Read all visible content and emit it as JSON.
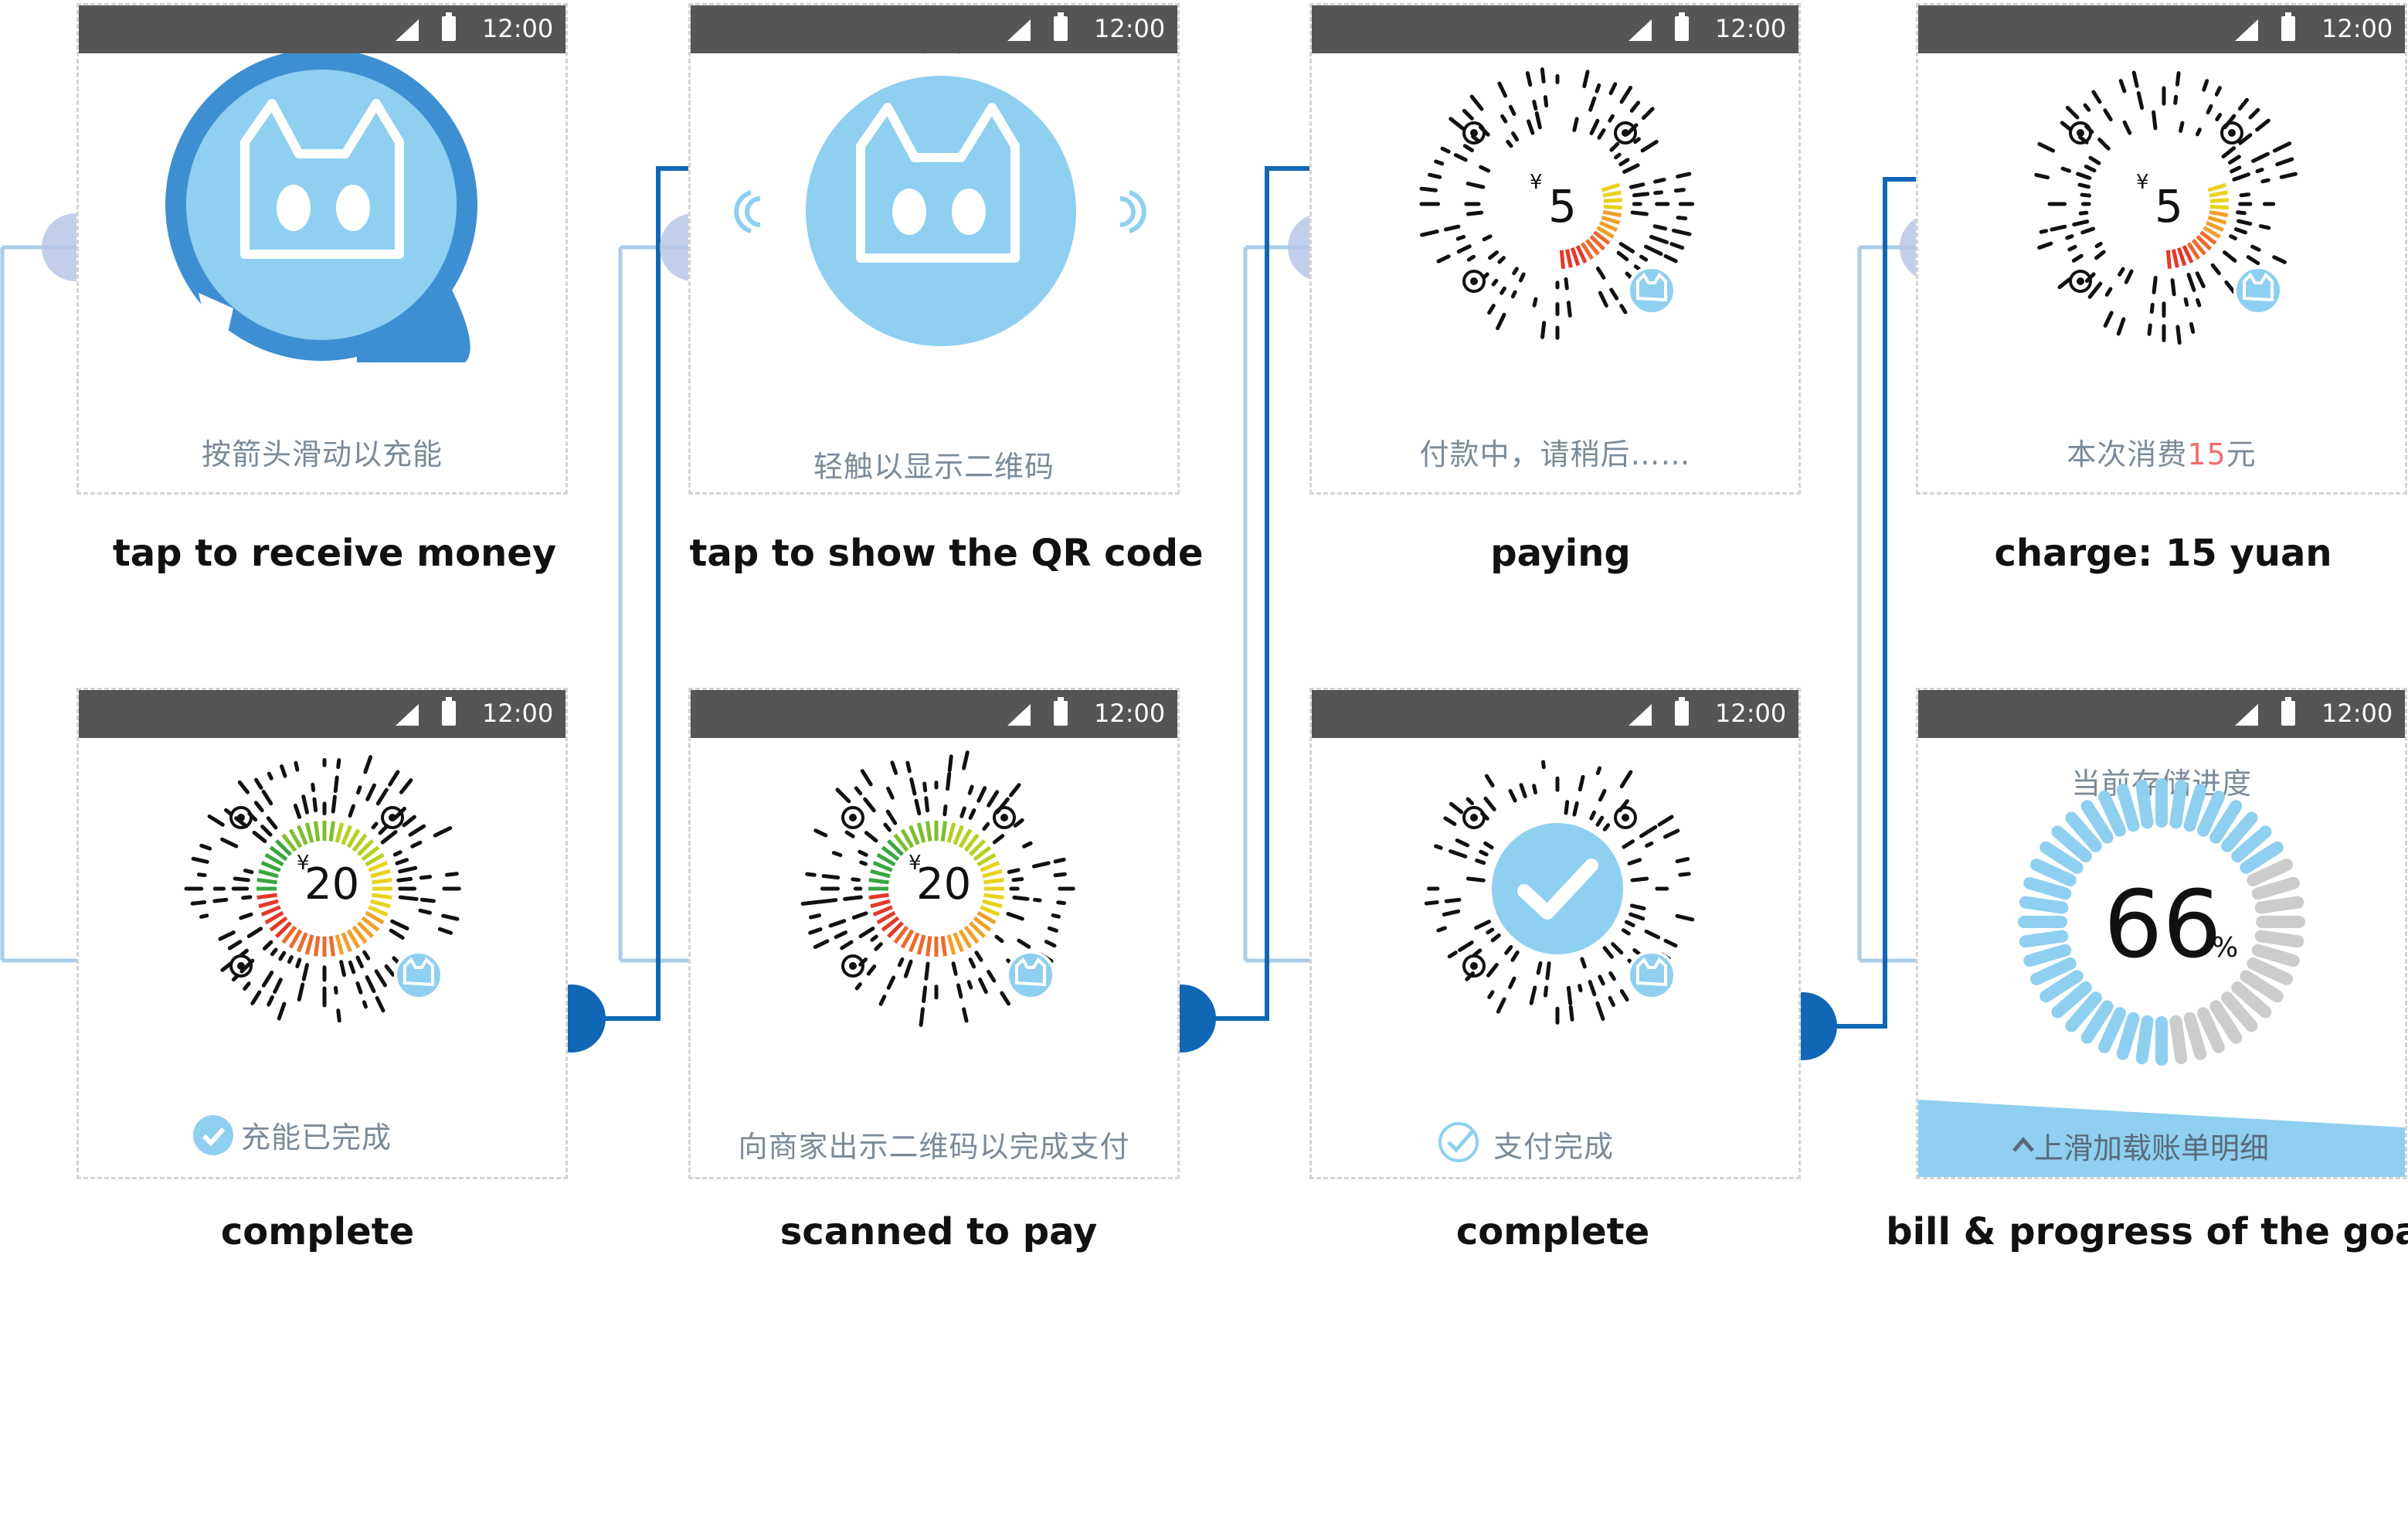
{
  "status": {
    "time": "12:00"
  },
  "screens": [
    {
      "caption": "按箭头滑动以充能",
      "label": "tap to receive money"
    },
    {
      "caption": "轻触以显示二维码",
      "label": "tap to show the QR code"
    },
    {
      "caption": "付款中，请稍后……",
      "label": "paying",
      "amount": "5",
      "currency": "¥"
    },
    {
      "caption_before": "本次消费",
      "caption_highlight": "15",
      "caption_after": "元",
      "label": "charge: 15 yuan",
      "amount": "5",
      "currency": "¥"
    },
    {
      "caption": "充能已完成",
      "label": "complete",
      "amount": "20",
      "currency": "¥"
    },
    {
      "caption": "向商家出示二维码以完成支付",
      "label": "scanned to pay",
      "amount": "20",
      "currency": "¥"
    },
    {
      "caption": "支付完成",
      "label": "complete"
    },
    {
      "title": "当前存储进度",
      "progress_value": "66",
      "progress_unit": "%",
      "progress_fraction": 0.66,
      "slide_hint": "上滑加载账单明细",
      "label": "bill & progress of the goal"
    }
  ],
  "colors": {
    "accent_blue": "#1166b5",
    "light_blue": "#8fcff0",
    "connector_light": "#a9cde9",
    "mid_blue": "#3e8fd2",
    "node_faded": "#b9c6e6",
    "highlight_red": "#f06d6d",
    "status_gray": "#555555"
  }
}
